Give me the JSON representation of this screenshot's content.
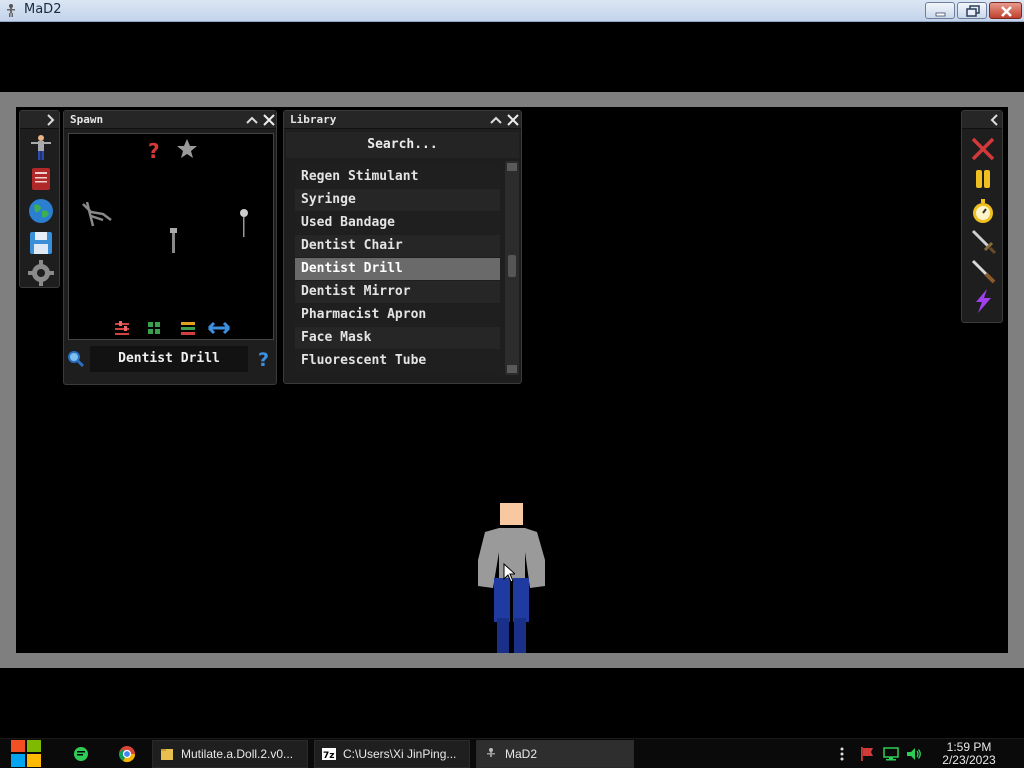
{
  "window": {
    "title": "MaD2"
  },
  "spawn_panel": {
    "title": "Spawn",
    "selected_item": "Dentist Drill"
  },
  "library_panel": {
    "title": "Library",
    "search_placeholder": "Search...",
    "items": [
      "Regen Stimulant",
      "Syringe",
      "Used Bandage",
      "Dentist Chair",
      "Dentist Drill",
      "Dentist Mirror",
      "Pharmacist Apron",
      "Face Mask",
      "Fluorescent Tube"
    ],
    "selected_index": 4
  },
  "left_toolbar": {
    "icons": [
      "ragdoll-icon",
      "book-icon",
      "globe-icon",
      "save-icon",
      "gear-icon"
    ]
  },
  "right_toolbar": {
    "icons": [
      "close-icon",
      "pause-icon",
      "stopwatch-icon",
      "sword-icon",
      "knife-icon",
      "lightning-icon"
    ]
  },
  "taskbar": {
    "tasks": [
      {
        "label": "Mutilate.a.Doll.2.v0...",
        "icon": "folder-icon"
      },
      {
        "label": "C:\\Users\\Xi JinPing...",
        "icon": "archive-icon"
      },
      {
        "label": "MaD2",
        "icon": "app-icon"
      }
    ],
    "clock": {
      "time": "1:59 PM",
      "date": "2/23/2023"
    }
  },
  "colors": {
    "accent_red": "#d23a3a",
    "help_blue": "#3d8fe0",
    "pause_yellow": "#f0c020",
    "lightning_purple": "#a040f0",
    "selected_row": "#6a6a6a"
  }
}
